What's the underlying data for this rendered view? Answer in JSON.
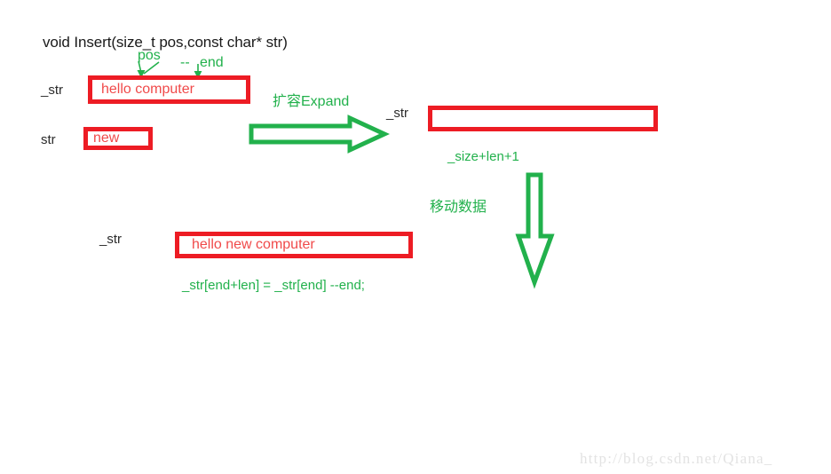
{
  "diagram": {
    "title": "void Insert(size_t pos,const char* str)",
    "annotations": {
      "pos_label": "pos",
      "end_label": "end",
      "end_dashes": "--"
    },
    "rows": {
      "source": {
        "name_label": "_str",
        "box_text": "hello computer"
      },
      "insert": {
        "name_label": "str",
        "box_text": "new"
      },
      "expanded": {
        "name_label": "_str",
        "box_text": "",
        "capacity_note": "_size+len+1"
      },
      "result": {
        "name_label": "_str",
        "box_text": "hello new computer",
        "formula": "_str[end+len] = _str[end]  --end;"
      }
    },
    "steps": {
      "expand_label": "扩容Expand",
      "move_data_label": "移动数据"
    },
    "watermark": "http://blog.csdn.net/Qiana_",
    "colors": {
      "box_border": "#ed1c24",
      "box_text": "#f04a4a",
      "arrow_green": "#22b14c",
      "title_text": "#1a1a1a",
      "watermark": "#e3e3e3"
    }
  }
}
